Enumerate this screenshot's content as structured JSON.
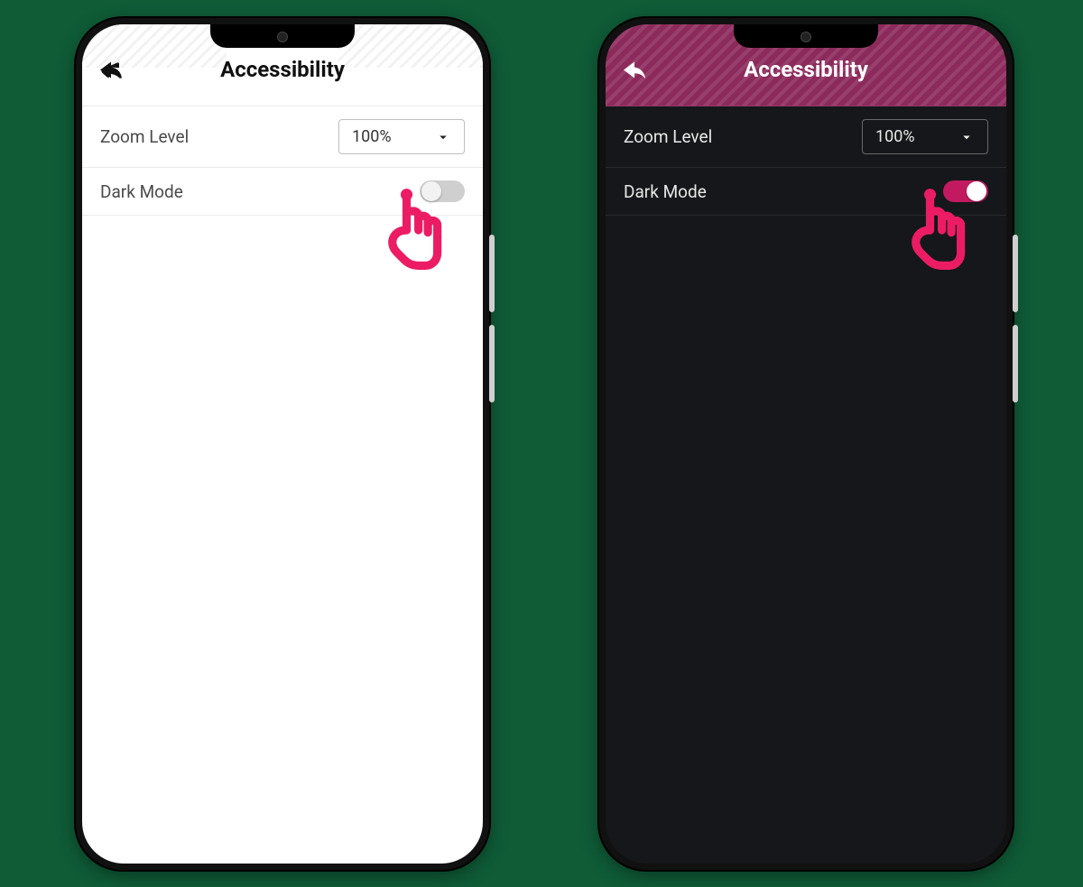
{
  "title": "Accessibility",
  "rows": {
    "zoom": {
      "label": "Zoom Level",
      "value": "100%"
    },
    "dark": {
      "label": "Dark Mode"
    }
  },
  "phones": {
    "light": {
      "dark_mode_on": false
    },
    "dark": {
      "dark_mode_on": true
    }
  },
  "colors": {
    "accent": "#ec1c64",
    "header_dark": "#8c2a5c",
    "bg_dark": "#15171a"
  }
}
